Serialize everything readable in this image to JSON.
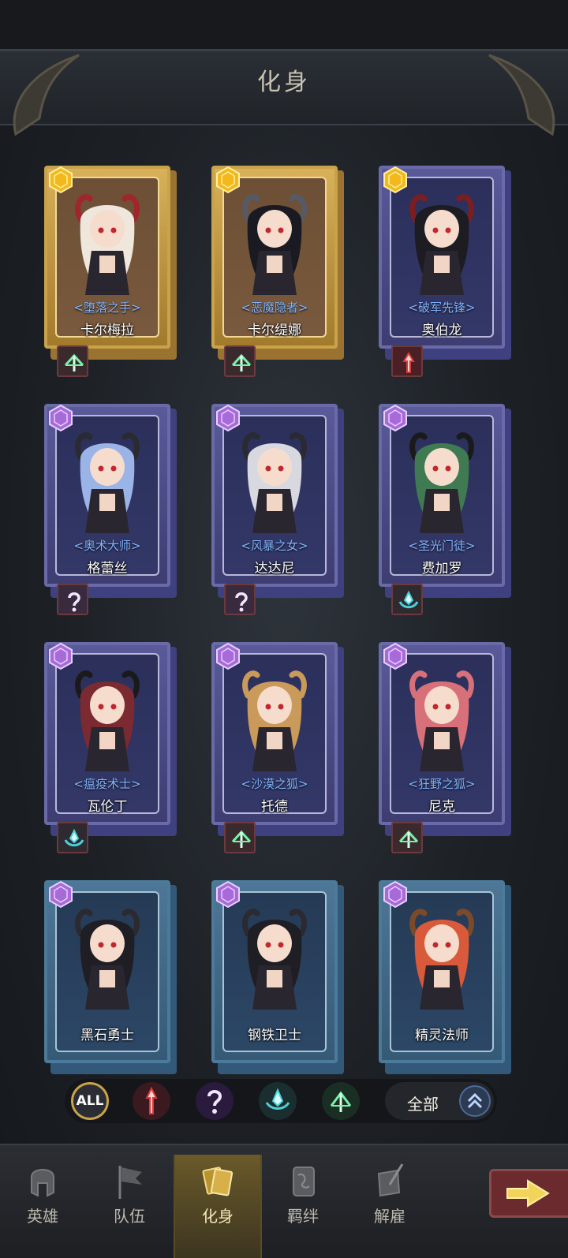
{
  "header": {
    "title": "化身"
  },
  "cards": [
    {
      "name": "卡尔梅拉",
      "epithet": "<堕落之手>",
      "rarity": "gold",
      "class_icon": "ranger-icon",
      "hair": "#efe6dc",
      "horns": "#a0252d"
    },
    {
      "name": "卡尔缇娜",
      "epithet": "<恶魔隐者>",
      "rarity": "gold",
      "class_icon": "ranger-icon",
      "hair": "#1a1a22",
      "horns": "#555a66"
    },
    {
      "name": "奥伯龙",
      "epithet": "<破军先锋>",
      "rarity": "gold-purple",
      "class_icon": "warrior-icon",
      "hair": "#1c1c22",
      "horns": "#7a1e22"
    },
    {
      "name": "格蕾丝",
      "epithet": "<奥术大师>",
      "rarity": "purple",
      "class_icon": "mage-icon",
      "hair": "#9bb4e8",
      "horns": "#2a2a30"
    },
    {
      "name": "达达尼",
      "epithet": "<风暴之女>",
      "rarity": "purple",
      "class_icon": "mage-icon",
      "hair": "#d8d8e0",
      "horns": "#2a2a30"
    },
    {
      "name": "费加罗",
      "epithet": "<圣光门徒>",
      "rarity": "purple",
      "class_icon": "priest-icon",
      "hair": "#3f7a52",
      "horns": "#1a1a1a"
    },
    {
      "name": "瓦伦丁",
      "epithet": "<瘟疫术士>",
      "rarity": "purple",
      "class_icon": "priest-icon",
      "hair": "#7a2a30",
      "horns": "#1a1a1a"
    },
    {
      "name": "托德",
      "epithet": "<沙漠之狐>",
      "rarity": "purple",
      "class_icon": "ranger-icon",
      "hair": "#c99a5a",
      "horns": "#c99a5a"
    },
    {
      "name": "尼克",
      "epithet": "<狂野之狐>",
      "rarity": "purple",
      "class_icon": "ranger-icon",
      "hair": "#d8707a",
      "horns": "#d8707a"
    },
    {
      "name": "黑石勇士",
      "epithet": "",
      "rarity": "blue",
      "class_icon": "",
      "hair": "#1e1e24",
      "horns": "#2a2a30"
    },
    {
      "name": "钢铁卫士",
      "epithet": "",
      "rarity": "blue",
      "class_icon": "",
      "hair": "#1e1e24",
      "horns": "#2a2a30"
    },
    {
      "name": "精灵法师",
      "epithet": "",
      "rarity": "blue",
      "class_icon": "",
      "hair": "#d85a3a",
      "horns": "#7a4a2a"
    }
  ],
  "filters": {
    "all_label": "ALL",
    "icons": [
      "warrior-icon",
      "mage-icon",
      "priest-icon",
      "ranger-icon"
    ],
    "sort_label": "全部"
  },
  "nav": {
    "items": [
      {
        "label": "英雄",
        "icon": "helmet-icon"
      },
      {
        "label": "队伍",
        "icon": "flag-icon"
      },
      {
        "label": "化身",
        "icon": "cards-icon",
        "active": true
      },
      {
        "label": "羁绊",
        "icon": "scroll-icon"
      },
      {
        "label": "解雇",
        "icon": "quill-icon"
      }
    ]
  },
  "colors": {
    "gold": "#c9a24a",
    "purple": "#6a6aa8",
    "blue": "#4c7a9a",
    "epithet": "#7fb4ff"
  }
}
